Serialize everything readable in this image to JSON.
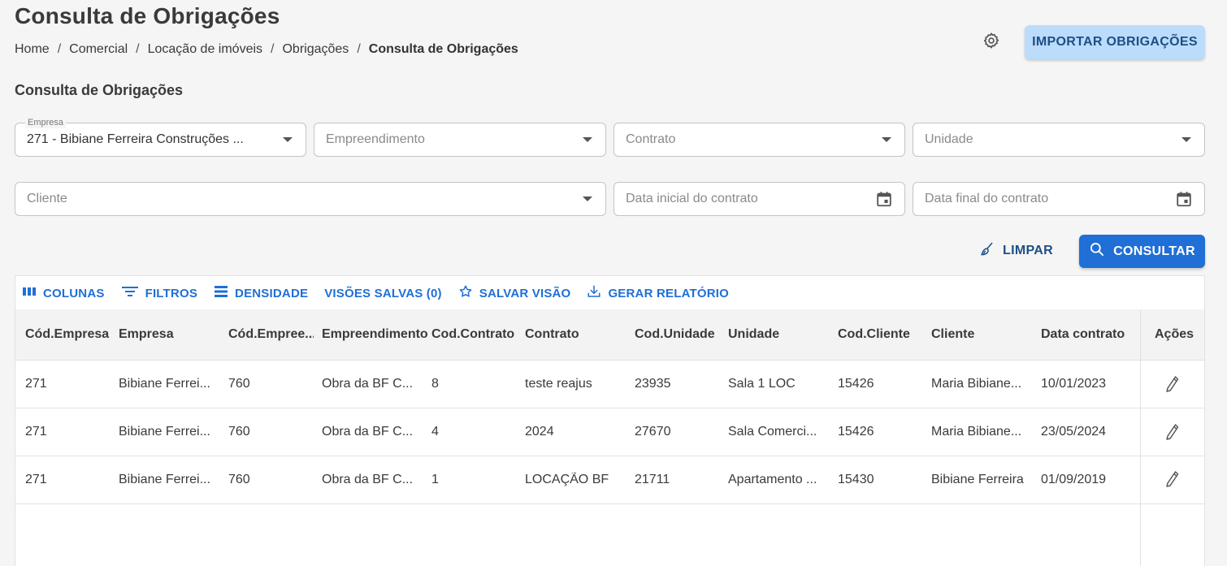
{
  "page": {
    "title": "Consulta de Obrigações",
    "breadcrumb": [
      "Home",
      "Comercial",
      "Locação de imóveis",
      "Obrigações",
      "Consulta de Obrigações"
    ],
    "import_button": "IMPORTAR OBRIGAÇÕES",
    "settings_icon": "gear-icon"
  },
  "filters": {
    "section_title": "Consulta de Obrigações",
    "empresa": {
      "label": "Empresa",
      "value": "271 - Bibiane Ferreira Construções ..."
    },
    "empreendimento": {
      "placeholder": "Empreendimento"
    },
    "contrato": {
      "placeholder": "Contrato"
    },
    "unidade": {
      "placeholder": "Unidade"
    },
    "cliente": {
      "placeholder": "Cliente"
    },
    "data_inicial": {
      "placeholder": "Data inicial do contrato"
    },
    "data_final": {
      "placeholder": "Data final do contrato"
    },
    "limpar_button": "LIMPAR",
    "consultar_button": "CONSULTAR"
  },
  "grid": {
    "toolbar": {
      "colunas": "COLUNAS",
      "filtros": "FILTROS",
      "densidade": "DENSIDADE",
      "visoes_salvas": "VISÕES SALVAS (0)",
      "salvar_visao": "SALVAR VISÃO",
      "gerar_relatorio": "GERAR RELATÓRIO"
    },
    "columns": [
      "Cód.Empresa",
      "Empresa",
      "Cód.Empree...",
      "Empreendimento",
      "Cod.Contrato",
      "Contrato",
      "Cod.Unidade",
      "Unidade",
      "Cod.Cliente",
      "Cliente",
      "Data contrato",
      "Ações"
    ],
    "rows": [
      [
        "271",
        "Bibiane Ferrei...",
        "760",
        "Obra da BF C...",
        "8",
        "teste reajus",
        "23935",
        "Sala 1 LOC",
        "15426",
        "Maria Bibiane...",
        "10/01/2023"
      ],
      [
        "271",
        "Bibiane Ferrei...",
        "760",
        "Obra da BF C...",
        "4",
        "2024",
        "27670",
        "Sala Comerci...",
        "15426",
        "Maria Bibiane...",
        "23/05/2024"
      ],
      [
        "271",
        "Bibiane Ferrei...",
        "760",
        "Obra da BF C...",
        "1",
        "LOCAÇÃO BF",
        "21711",
        "Apartamento ...",
        "15430",
        "Bibiane Ferreira",
        "01/09/2019"
      ]
    ]
  },
  "colors": {
    "primary": "#1f6fd6",
    "import_bg": "#bcdcfb",
    "import_text": "#1d4f86"
  }
}
